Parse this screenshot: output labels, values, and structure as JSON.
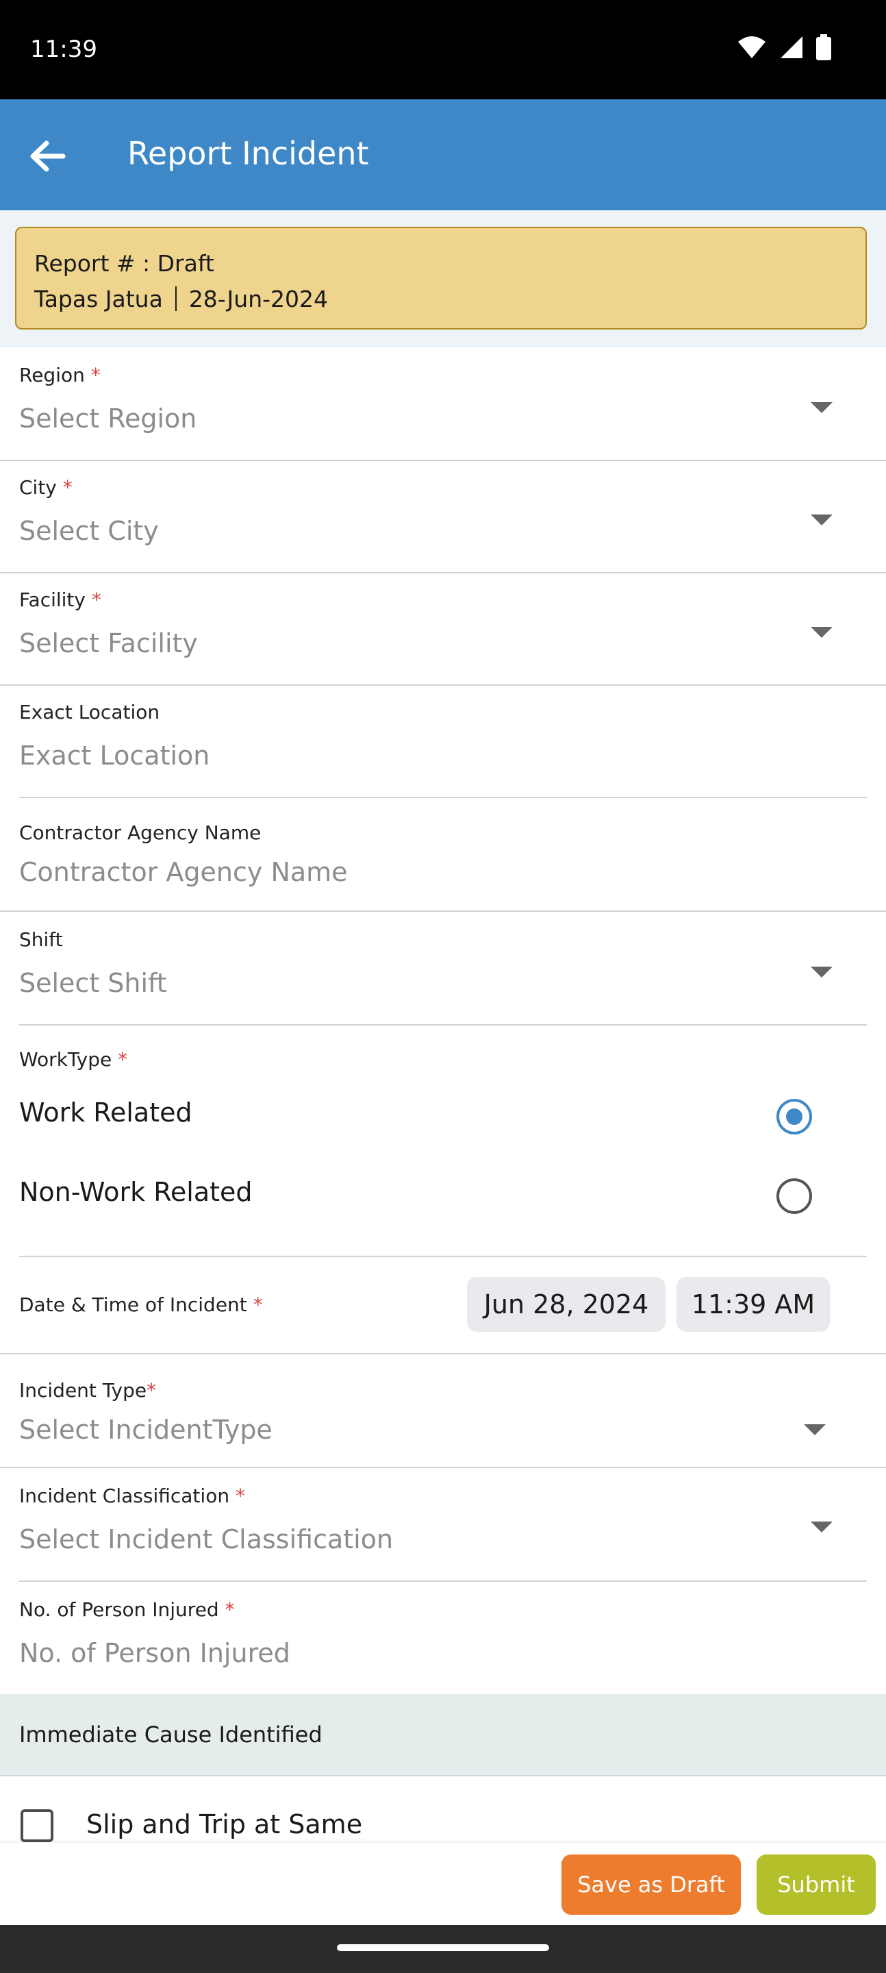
{
  "status_bar": {
    "time": "11:39"
  },
  "app_bar": {
    "title": "Report Incident"
  },
  "banner": {
    "report_line": "Report # : Draft",
    "user": "Tapas Jatua",
    "date": "28-Jun-2024"
  },
  "form": {
    "region": {
      "label": "Region",
      "required": "*",
      "placeholder": "Select Region"
    },
    "city": {
      "label": "City",
      "required": "*",
      "placeholder": "Select City"
    },
    "facility": {
      "label": "Facility",
      "required": "*",
      "placeholder": "Select Facility"
    },
    "exact_location": {
      "label": "Exact Location",
      "placeholder": "Exact Location"
    },
    "contractor": {
      "label": "Contractor Agency Name",
      "placeholder": "Contractor Agency Name"
    },
    "shift": {
      "label": "Shift",
      "placeholder": "Select Shift"
    },
    "worktype": {
      "label": "WorkType",
      "required": "*",
      "options": [
        {
          "label": "Work Related",
          "selected": true
        },
        {
          "label": "Non-Work Related",
          "selected": false
        }
      ]
    },
    "datetime": {
      "label": "Date & Time of Incident",
      "required": "*",
      "date": "Jun 28, 2024",
      "time": "11:39 AM"
    },
    "incident_type": {
      "label": "Incident Type",
      "required": "*",
      "placeholder": "Select IncidentType"
    },
    "classification": {
      "label": "Incident Classification",
      "required": "*",
      "placeholder": "Select Incident Classification"
    },
    "injured": {
      "label": "No. of Person Injured",
      "required": "*",
      "placeholder": "No. of Person Injured"
    }
  },
  "section": {
    "title": "Immediate Cause Identified"
  },
  "causes": [
    {
      "label": "Slip and Trip at Same",
      "checked": false
    }
  ],
  "buttons": {
    "save_draft": "Save as Draft",
    "submit": "Submit"
  },
  "colors": {
    "app_bar": "#3e88c8",
    "banner": "#efd48e",
    "save_draft": "#ed7c2e",
    "submit": "#b3c02a"
  }
}
